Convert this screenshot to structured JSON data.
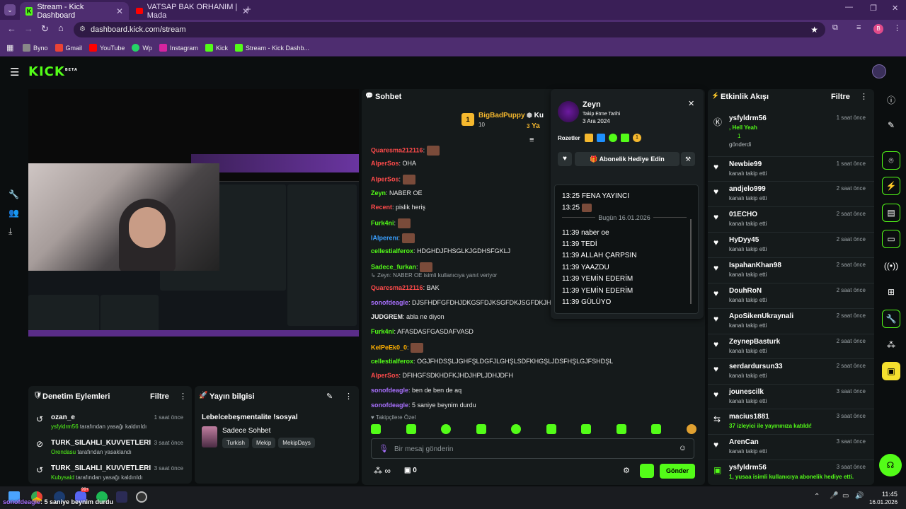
{
  "browser": {
    "tabs": [
      {
        "title": "Stream - Kick Dashboard",
        "active": true
      },
      {
        "title": "VATSAP BAK ORHANIM | Mada",
        "active": false
      }
    ],
    "url": "dashboard.kick.com/stream",
    "bookmarks": [
      "Byno",
      "Gmail",
      "YouTube",
      "Wp",
      "Instagram",
      "Kick",
      "Stream - Kick Dashb..."
    ]
  },
  "kick": {
    "logo": "KICK",
    "logo_badge": "BETA"
  },
  "moderation": {
    "title": "Denetim Eylemleri",
    "filter": "Filtre",
    "items": [
      {
        "user": "ozan_e",
        "by": "ysfyldrm56",
        "action": "tarafından yasağı kaldırıldı",
        "time": "1 saat önce"
      },
      {
        "user": "TURK_SILAHLI_KUVVETLERI",
        "by": "Orendasu",
        "action": "tarafından yasaklandı",
        "time": "3 saat önce"
      },
      {
        "user": "TURK_SILAHLI_KUVVETLERI",
        "by": "Kubysaid",
        "action": "tarafından yasağı kaldırıldı",
        "time": "3 saat önce"
      }
    ]
  },
  "stream_info": {
    "title": "Yayın bilgisi",
    "stream_title": "Lebelcebeşmentalite !sosyal",
    "category": "Sadece Sohbet",
    "tags": [
      "Turkish",
      "Mekip",
      "MekipDays"
    ]
  },
  "chat": {
    "title": "Sohbet",
    "top_gifter": {
      "name": "BigBadPuppy",
      "rank": "1",
      "count": "10"
    },
    "top_gifter_2": {
      "rank": "3",
      "name_partial": "Ku",
      "name_partial2": "Ya"
    },
    "messages": [
      {
        "user": "Quaresma212116",
        "color": "#ff4b4b",
        "text": "",
        "emote": true
      },
      {
        "user": "AlperSos",
        "color": "#ff4b4b",
        "text": "OHA",
        "emote": false
      },
      {
        "user": "AlperSos",
        "color": "#ff4b4b",
        "text": "",
        "emote": true
      },
      {
        "user": "Zeyn",
        "color": "#53fc18",
        "text": "NABER OE",
        "emote": false
      },
      {
        "user": "Recent",
        "color": "#ff4b4b",
        "text": "pislik heriş",
        "emote": false
      },
      {
        "user": "Furk4ni",
        "color": "#53fc18",
        "text": "",
        "emote": true
      },
      {
        "user": "IAlperenı",
        "color": "#3aa0ff",
        "text": "",
        "emote": true
      },
      {
        "user": "cellestialferox",
        "color": "#53fc18",
        "text": "HDGHDJFHSGLKJGDHSFGKLJ",
        "emote": false
      },
      {
        "user": "Sadece_furkan",
        "color": "#53fc18",
        "text": "",
        "emote": true
      },
      {
        "user": "Quaresma212116",
        "color": "#ff4b4b",
        "text": "BAK",
        "emote": false
      },
      {
        "user": "sonofdeagle",
        "color": "#a970ff",
        "text": "DJSFHDFGFDHJDKGSFDJKSGFDKJSGFDKJH",
        "emote": false
      },
      {
        "user": "JUDGREM",
        "color": "#e6e6e6",
        "text": "abla ne diyon",
        "emote": false
      },
      {
        "user": "Furk4ni",
        "color": "#53fc18",
        "text": "AFASDASFGASDAFVASD",
        "emote": false
      },
      {
        "user": "KelPeEk0_0",
        "color": "#ffb000",
        "text": "",
        "emote": true
      },
      {
        "user": "cellestialferox",
        "color": "#53fc18",
        "text": "OGJFHDSŞLJGHFŞLDGFJLGHŞLSDFKHGŞLJDSFHŞLGJFSHDŞL",
        "emote": false
      },
      {
        "user": "AlperSos",
        "color": "#ff4b4b",
        "text": "DFIHGFSDKHDFKJHDJHPLJDHJDFH",
        "emote": false
      },
      {
        "user": "sonofdeagle",
        "color": "#a970ff",
        "text": "ben de ben de aq",
        "emote": false
      },
      {
        "user": "sonofdeagle",
        "color": "#a970ff",
        "text": "5 saniye beynim durdu",
        "emote": false
      }
    ],
    "reply_hint": "Zeyn: NABER OE isimli kullanıcıya yanıt veriyor",
    "followers_special": "Takipçilere Özel",
    "input_placeholder": "Bir mesaj gönderin",
    "send": "Gönder",
    "points": "0",
    "infinity": "∞"
  },
  "user_card": {
    "name": "Zeyn",
    "follow_label": "Takip Etme Tarihi",
    "follow_date": "3 Ara 2024",
    "badges_label": "Rozetler",
    "badge_count": "1",
    "gift_button": "Abonelik Hediye Edin",
    "history": [
      {
        "time": "13:25",
        "text": "FENA YAYINCI"
      },
      {
        "time": "13:25",
        "text": ""
      },
      {
        "divider": "Bugün 16.01.2026"
      },
      {
        "time": "11:39",
        "text": "naber oe"
      },
      {
        "time": "11:39",
        "text": "TEDİ"
      },
      {
        "time": "11:39",
        "text": "ALLAH ÇARPSIN"
      },
      {
        "time": "11:39",
        "text": "YAAZDU"
      },
      {
        "time": "11:39",
        "text": "YEMİN EDERİM"
      },
      {
        "time": "11:39",
        "text": "YEMİN EDERİM"
      },
      {
        "time": "11:39",
        "text": "GÜLÜYO"
      }
    ]
  },
  "activity": {
    "title": "Etkinlik Akışı",
    "filter": "Filtre",
    "items": [
      {
        "name": "ysfyldrm56",
        "line1": ", Hell Yeah",
        "line2": "1",
        "line3": "gönderdi",
        "time": "1 saat önce",
        "type": "kick"
      },
      {
        "name": "Newbie99",
        "line1": "kanalı takip etti",
        "time": "1 saat önce",
        "type": "follow"
      },
      {
        "name": "andjelo999",
        "line1": "kanalı takip etti",
        "time": "2 saat önce",
        "type": "follow"
      },
      {
        "name": "01ECHO",
        "line1": "kanalı takip etti",
        "time": "2 saat önce",
        "type": "follow"
      },
      {
        "name": "HyDyy45",
        "line1": "kanalı takip etti",
        "time": "2 saat önce",
        "type": "follow"
      },
      {
        "name": "IspahanKhan98",
        "line1": "kanalı takip etti",
        "time": "2 saat önce",
        "type": "follow"
      },
      {
        "name": "DouhRoN",
        "line1": "kanalı takip etti",
        "time": "2 saat önce",
        "type": "follow"
      },
      {
        "name": "ApoSikenUkraynali",
        "line1": "kanalı takip etti",
        "time": "2 saat önce",
        "type": "follow"
      },
      {
        "name": "ZeynepBasturk",
        "line1": "kanalı takip etti",
        "time": "2 saat önce",
        "type": "follow"
      },
      {
        "name": "serdardursun33",
        "line1": "kanalı takip etti",
        "time": "2 saat önce",
        "type": "follow"
      },
      {
        "name": "jounescilk",
        "line1": "kanalı takip etti",
        "time": "3 saat önce",
        "type": "follow"
      },
      {
        "name": "macius1881",
        "line1": "37 izleyici ile yayınınıza katıldı!",
        "time": "3 saat önce",
        "type": "raid"
      },
      {
        "name": "ArenCan",
        "line1": "kanalı takip etti",
        "time": "3 saat önce",
        "type": "follow"
      },
      {
        "name": "ysfyldrm56",
        "line1": "1, yusaa isimli kullanıcıya abonelik hediye etti.",
        "time": "3 saat önce",
        "type": "gift"
      }
    ]
  },
  "taskbar": {
    "overlay_user": "sonofdeagle",
    "overlay_text": ": 5 saniye beynim durdu",
    "time": "11:45",
    "date": "16.01.2026",
    "badge": "99+"
  },
  "colors": {
    "accent": "#53fc18",
    "panel": "#151a1b",
    "bg": "#0b0e0f",
    "chrome": "#4e2d70"
  }
}
